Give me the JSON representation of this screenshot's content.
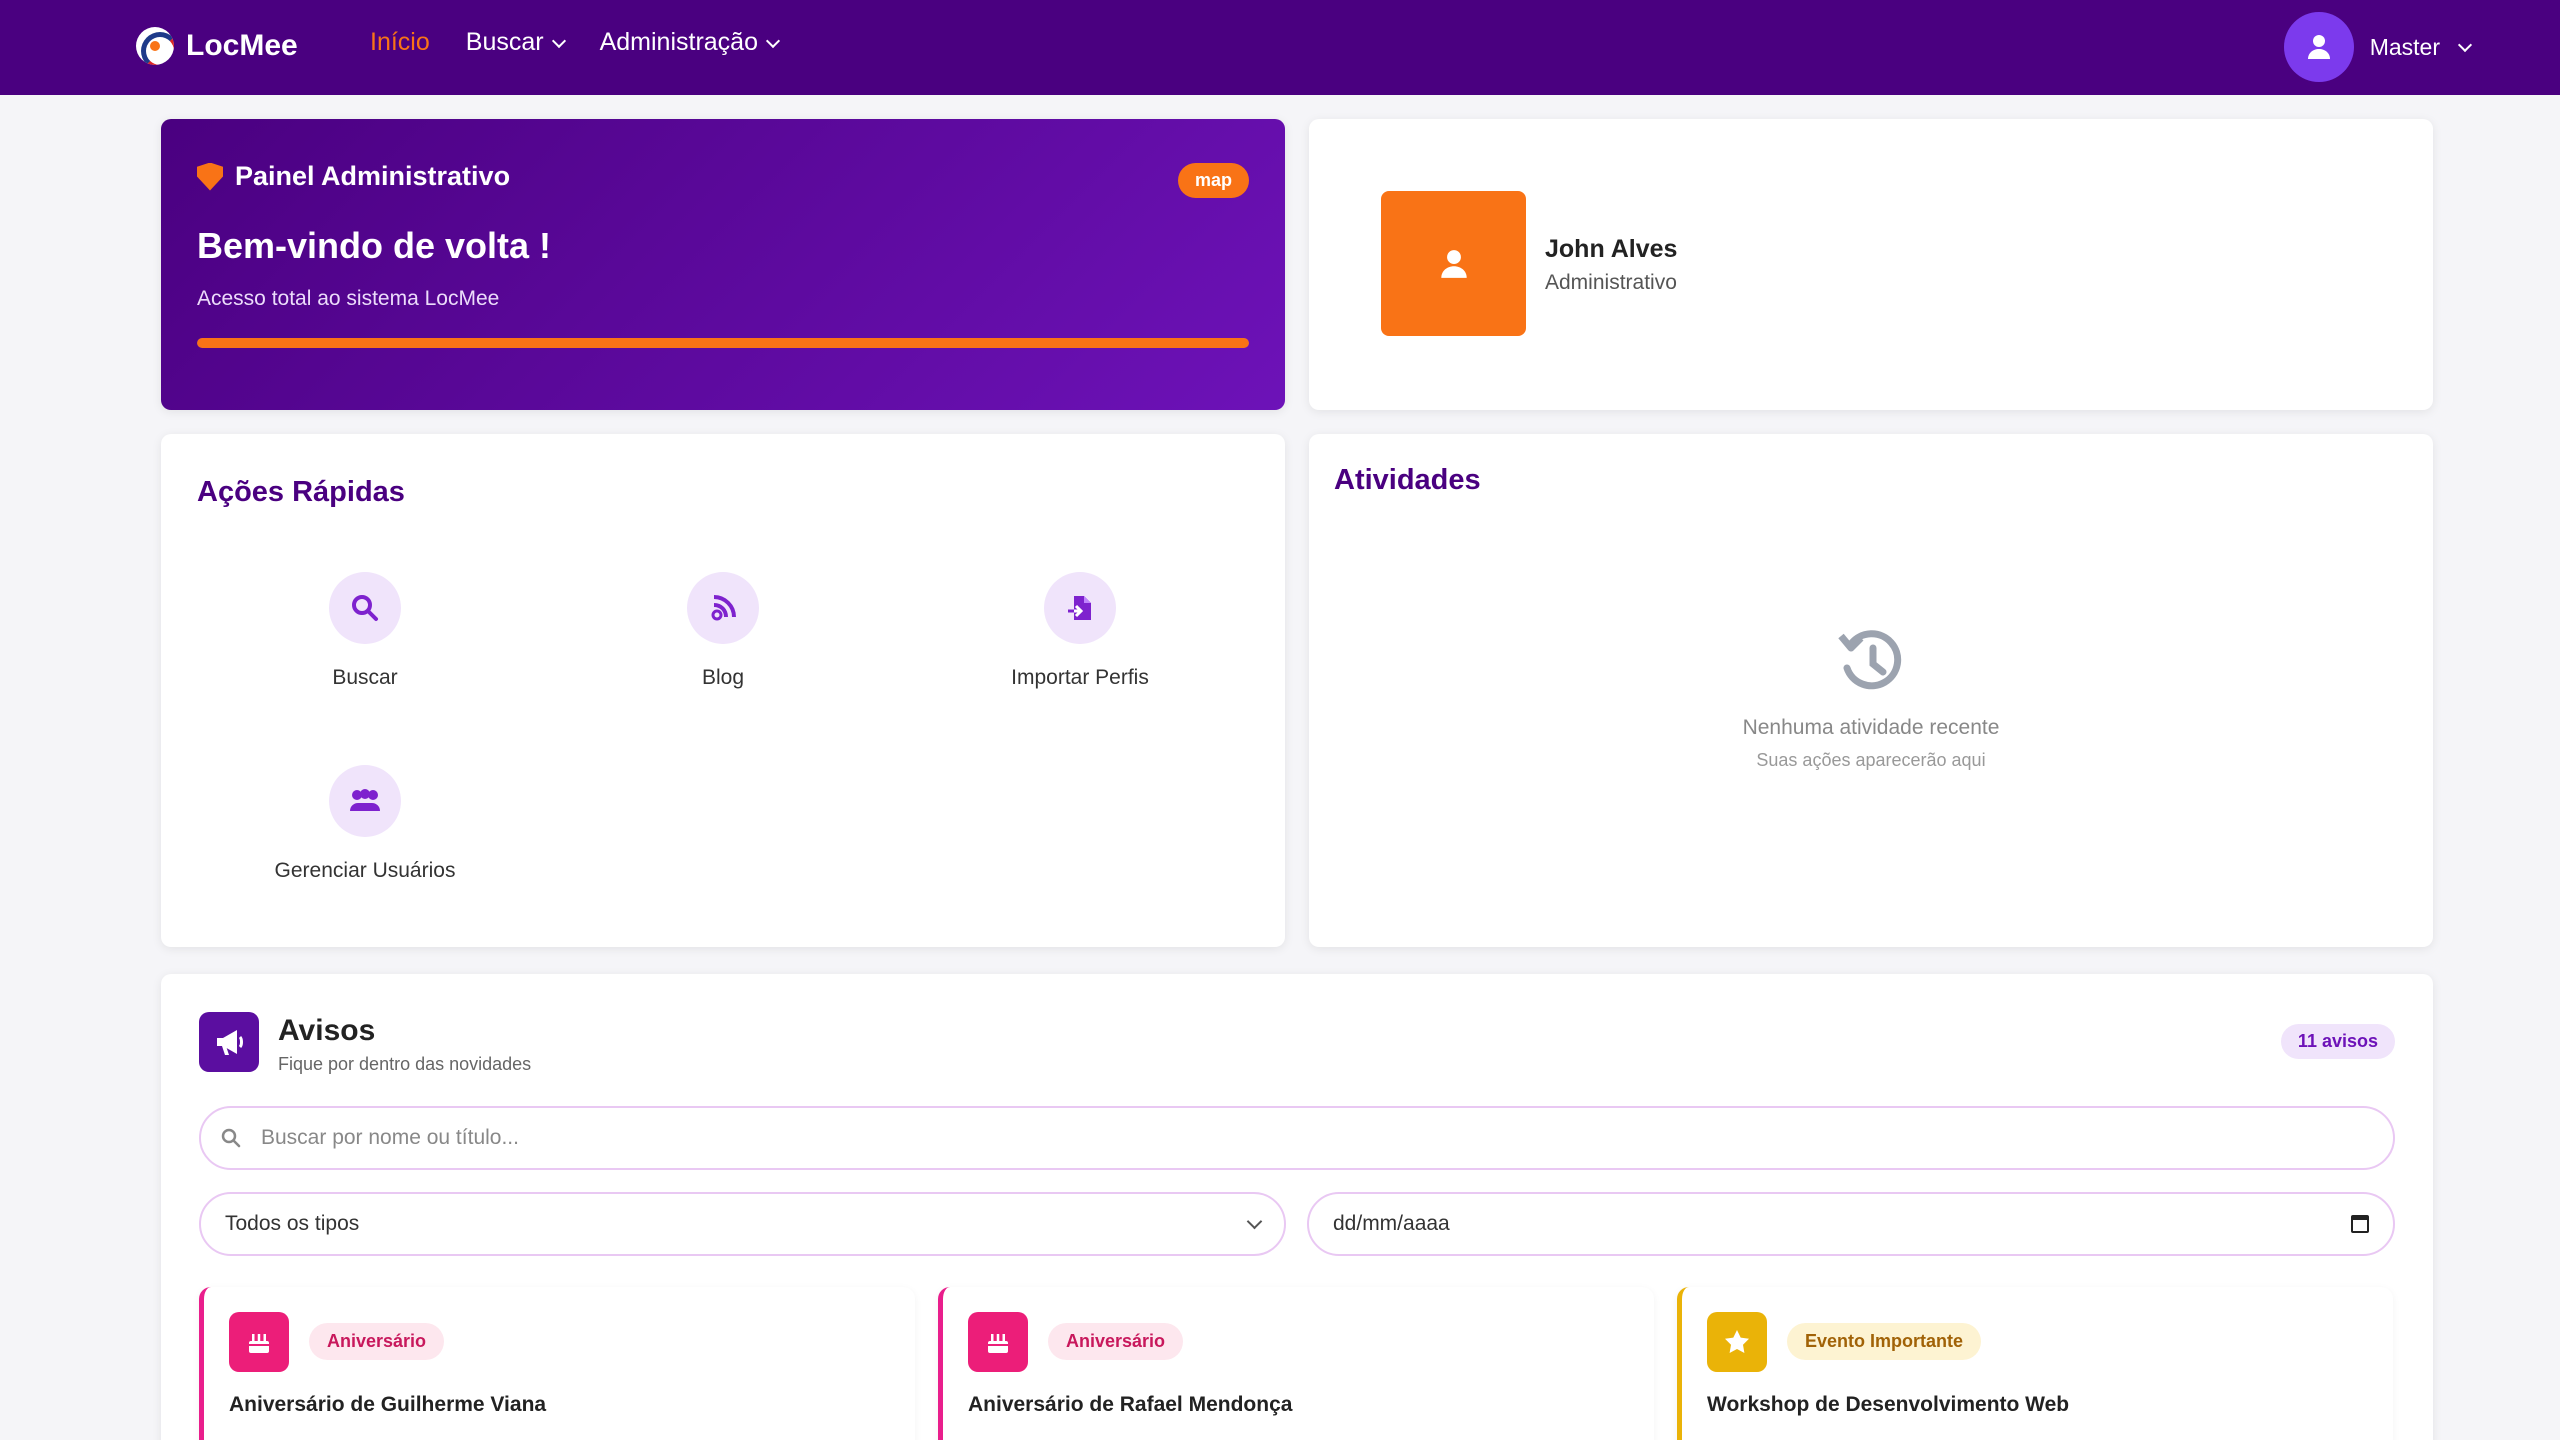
{
  "nav": {
    "brand": "LocMee",
    "links": [
      {
        "label": "Início",
        "active": true
      },
      {
        "label": "Buscar",
        "has_dropdown": true
      },
      {
        "label": "Administração",
        "has_dropdown": true
      }
    ],
    "user_label": "Master"
  },
  "admin_panel": {
    "heading": "Painel Administrativo",
    "badge": "map",
    "welcome": "Bem-vindo de volta !",
    "subtitle": "Acesso total ao sistema LocMee",
    "progress": 1.0
  },
  "profile": {
    "name": "John Alves",
    "role": "Administrativo"
  },
  "quick_actions": {
    "title": "Ações Rápidas",
    "items": [
      {
        "label": "Buscar",
        "icon": "search-icon"
      },
      {
        "label": "Blog",
        "icon": "blog-icon"
      },
      {
        "label": "Importar Perfis",
        "icon": "import-icon"
      },
      {
        "label": "Gerenciar Usuários",
        "icon": "users-icon"
      }
    ]
  },
  "activities": {
    "title": "Atividades",
    "empty_title": "Nenhuma atividade recente",
    "empty_subtitle": "Suas ações aparecerão aqui"
  },
  "notices": {
    "title": "Avisos",
    "subtitle": "Fique por dentro das novidades",
    "count": "11 avisos",
    "search_placeholder": "Buscar por nome ou título...",
    "type_filter": "Todos os tipos",
    "date_placeholder": "dd/mm/aaaa",
    "items": [
      {
        "tag": "Aniversário",
        "title": "Aniversário de Guilherme Viana",
        "icon": "cake-icon"
      },
      {
        "tag": "Aniversário",
        "title": "Aniversário de Rafael Mendonça",
        "icon": "cake-icon"
      },
      {
        "tag": "Evento Importante",
        "title": "Workshop de Desenvolvimento Web",
        "icon": "star-icon"
      }
    ]
  },
  "colors": {
    "primary": "#4a0080",
    "accent": "#f97316",
    "birthday": "#ec1e79",
    "event": "#eab308"
  }
}
